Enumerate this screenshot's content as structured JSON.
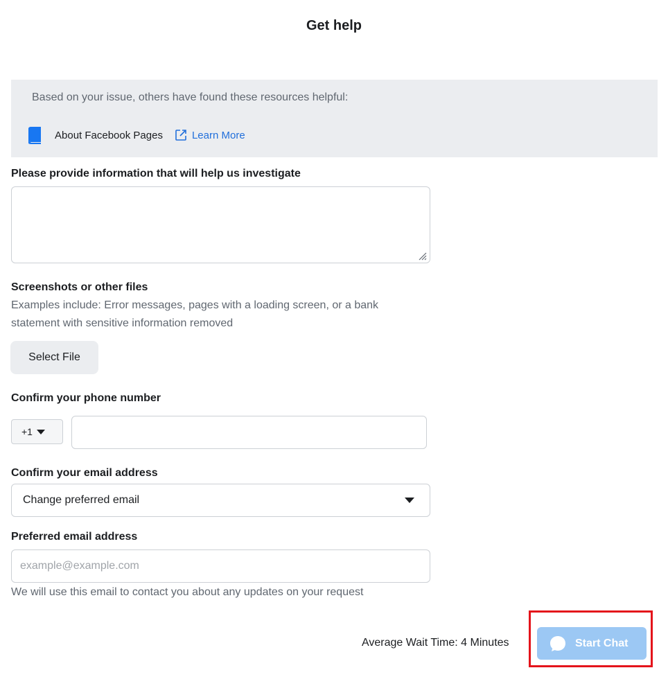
{
  "page": {
    "title": "Get help"
  },
  "resources": {
    "intro": "Based on your issue, others have found these resources helpful:",
    "items": [
      {
        "icon": "book-icon",
        "title": "About Facebook Pages",
        "link_label": "Learn More"
      }
    ]
  },
  "form": {
    "investigate": {
      "label": "Please provide information that will help us investigate",
      "value": ""
    },
    "files": {
      "label": "Screenshots or other files",
      "help_line1": "Examples include: Error messages, pages with a loading screen, or a bank",
      "help_line2": "statement with sensitive information removed",
      "button_label": "Select File"
    },
    "phone": {
      "label": "Confirm your phone number",
      "country_code": "+1",
      "value": ""
    },
    "email": {
      "label": "Confirm your email address",
      "selected": "Change preferred email"
    },
    "preferred_email": {
      "label": "Preferred email address",
      "placeholder": "example@example.com",
      "value": "",
      "help": "We will use this email to contact you about any updates on your request"
    }
  },
  "footer": {
    "wait_time": "Average Wait Time: 4 Minutes",
    "start_chat_label": "Start Chat"
  },
  "colors": {
    "link": "#216fdb",
    "resource_bg": "#ebedf0",
    "button_disabled": "#9cc8f4",
    "highlight": "#e4141b",
    "book_icon": "#1877f2"
  }
}
